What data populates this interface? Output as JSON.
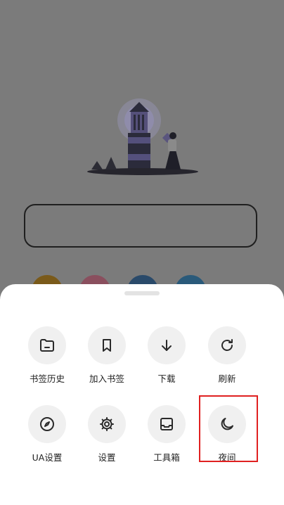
{
  "menu": {
    "row1": [
      {
        "label": "书签历史",
        "icon": "folder-icon"
      },
      {
        "label": "加入书签",
        "icon": "bookmark-icon"
      },
      {
        "label": "下载",
        "icon": "download-icon"
      },
      {
        "label": "刷新",
        "icon": "refresh-icon"
      }
    ],
    "row2": [
      {
        "label": "UA设置",
        "icon": "compass-icon"
      },
      {
        "label": "设置",
        "icon": "gear-icon"
      },
      {
        "label": "工具箱",
        "icon": "inbox-icon"
      },
      {
        "label": "夜间",
        "icon": "moon-icon"
      }
    ]
  },
  "colors": {
    "overlay": "#7b7b7b",
    "sheet": "#ffffff",
    "icon_circle": "#f0f0f0",
    "highlight": "#e02020",
    "shortcut_dots": [
      "#7a5a1a",
      "#8a4f5e",
      "#2a4a6a",
      "#2a5a7a"
    ]
  }
}
